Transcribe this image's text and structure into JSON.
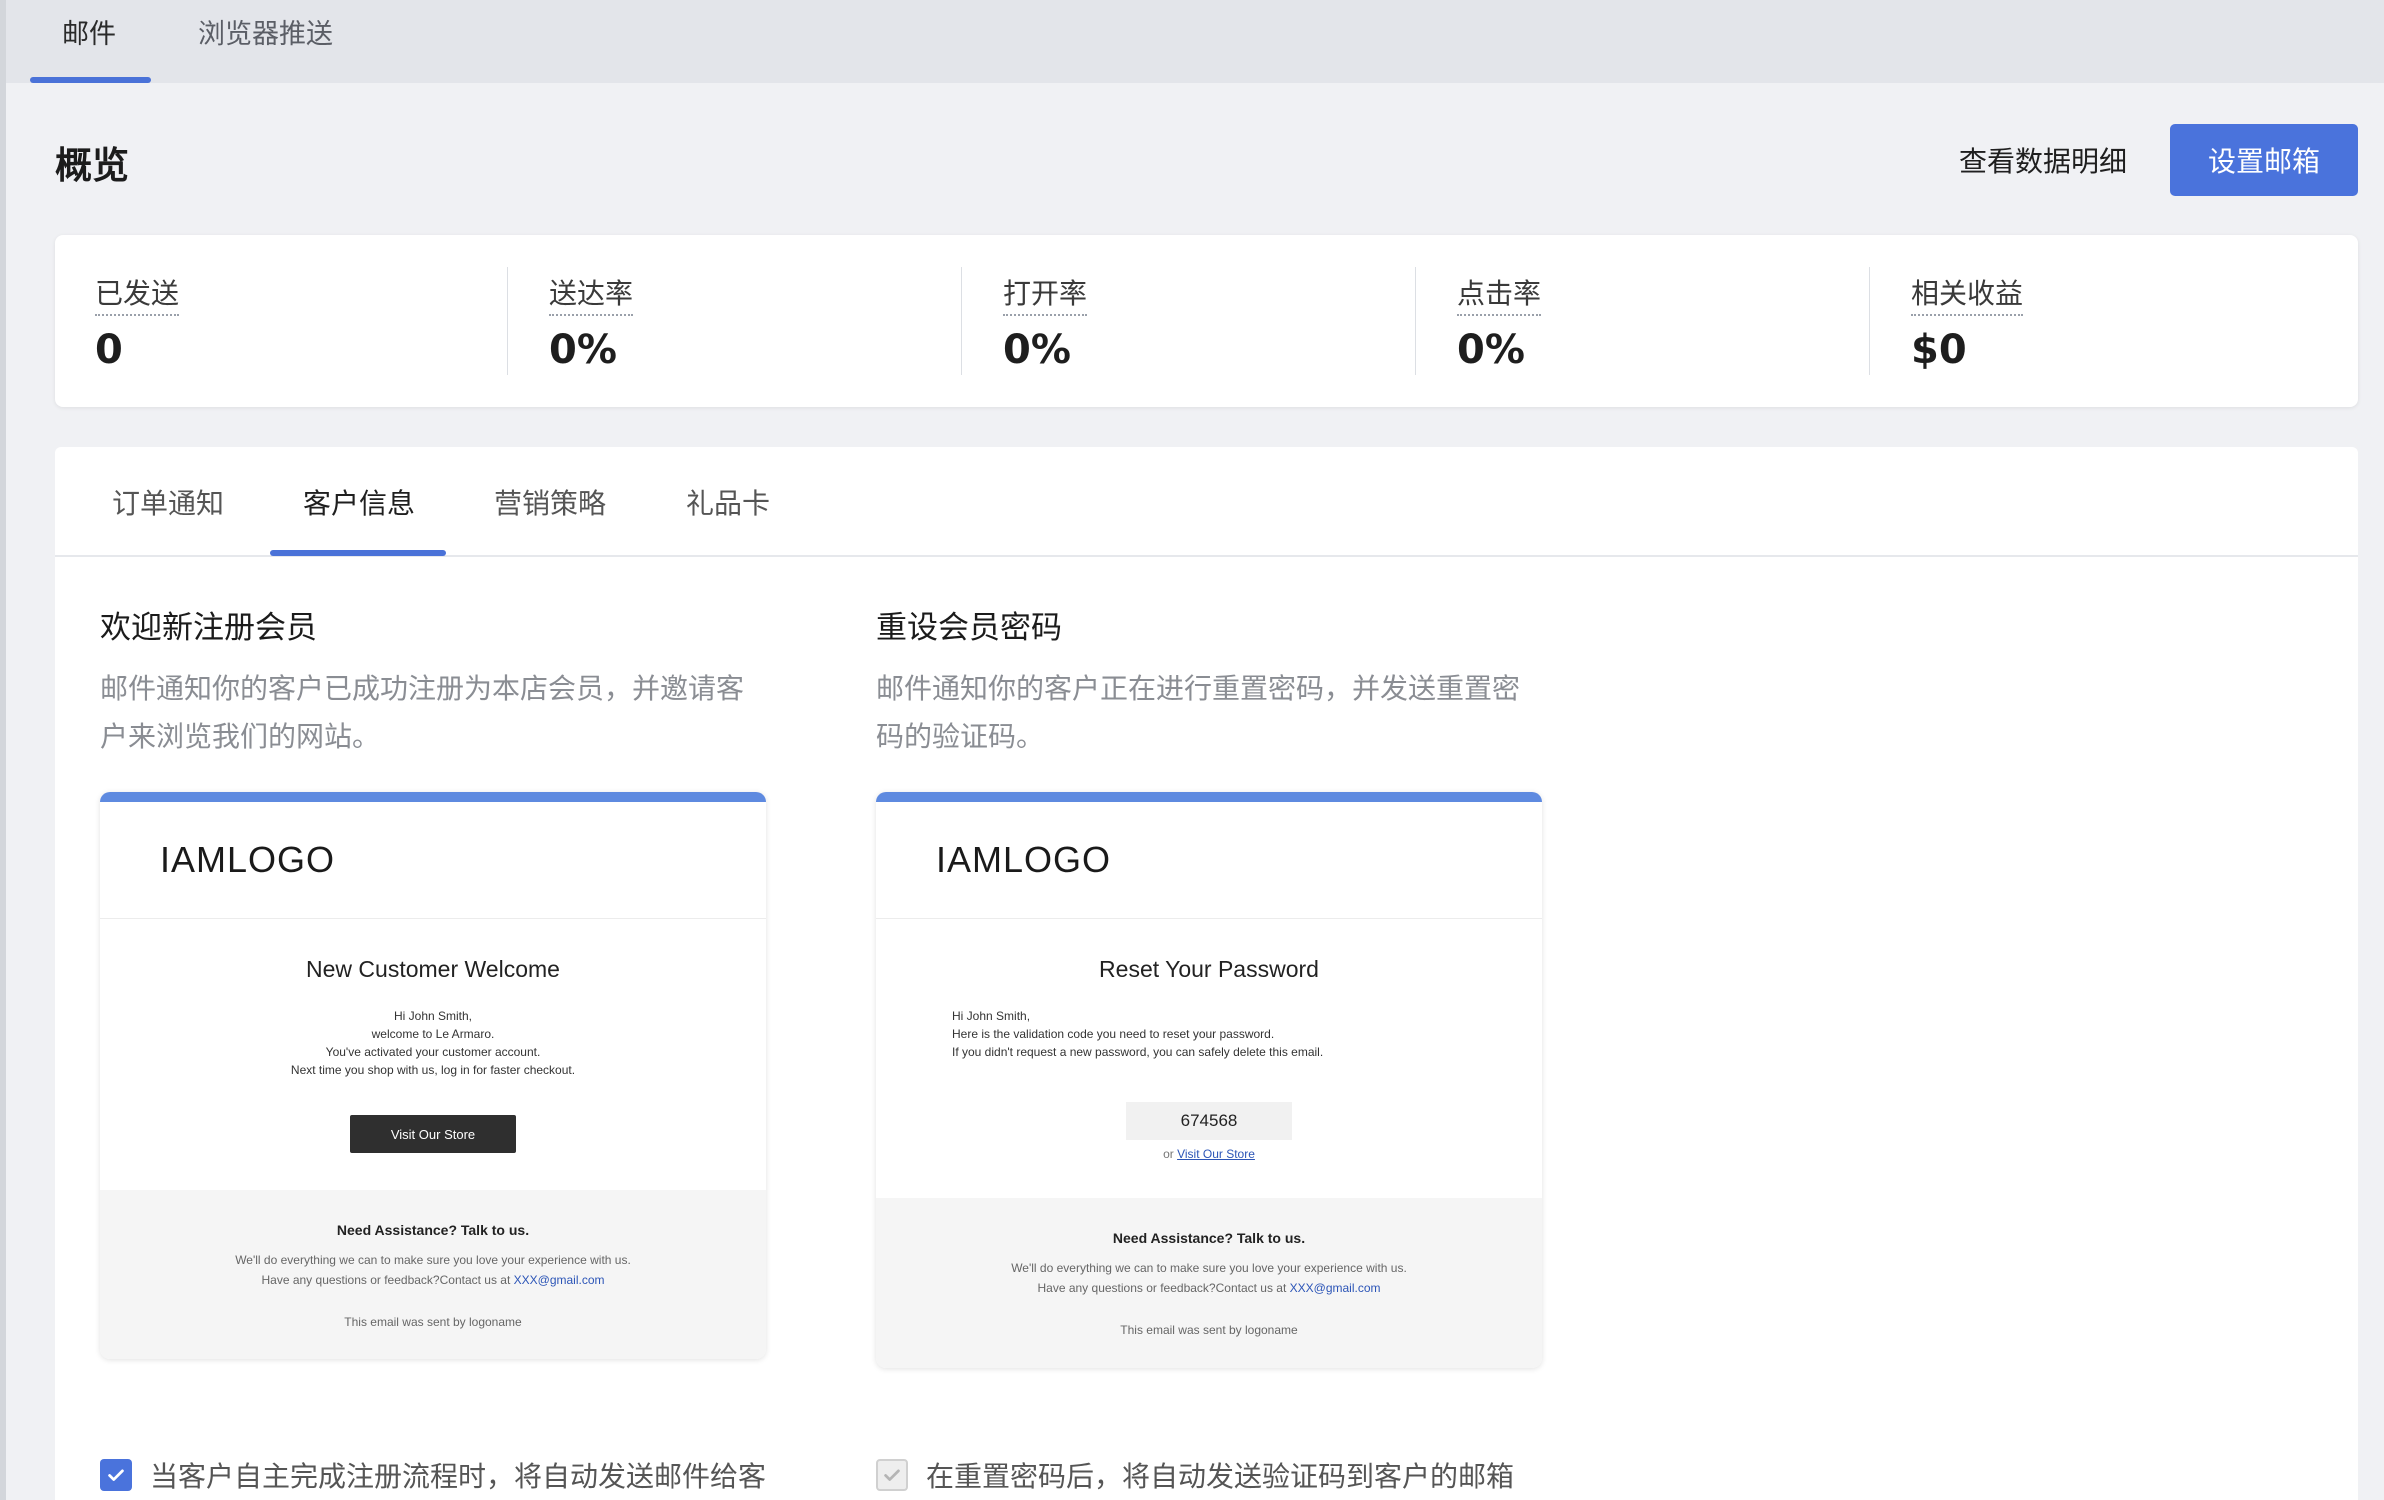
{
  "top_tabs": [
    {
      "label": "邮件",
      "active": true
    },
    {
      "label": "浏览器推送",
      "active": false
    }
  ],
  "overview": {
    "title": "概览",
    "details_link": "查看数据明细",
    "setup_button": "设置邮箱"
  },
  "stats": [
    {
      "label": "已发送",
      "value": "0"
    },
    {
      "label": "送达率",
      "value": "0%"
    },
    {
      "label": "打开率",
      "value": "0%"
    },
    {
      "label": "点击率",
      "value": "0%"
    },
    {
      "label": "相关收益",
      "value": "$0"
    }
  ],
  "sub_tabs": [
    {
      "label": "订单通知",
      "active": false
    },
    {
      "label": "客户信息",
      "active": true
    },
    {
      "label": "营销策略",
      "active": false
    },
    {
      "label": "礼品卡",
      "active": false
    }
  ],
  "cards": [
    {
      "title": "欢迎新注册会员",
      "description": "邮件通知你的客户已成功注册为本店会员，并邀请客户来浏览我们的网站。",
      "preview": {
        "logo": "IAMLOGO",
        "heading": "New Customer Welcome",
        "body": [
          "Hi  John Smith,",
          "welcome to Le Armaro.",
          "You've activated your customer account.",
          "Next time you shop with us, log in for faster checkout."
        ],
        "button": "Visit Our Store",
        "footer_title": "Need Assistance? Talk to us.",
        "footer_line1": "We'll do everything we can to make sure you love your experience with us.",
        "footer_line2_prefix": "Have any questions or feedback?Contact us at ",
        "footer_email": "XXX@gmail.com",
        "footer_sent": "This email was sent by logoname"
      },
      "checkbox_label": "当客户自主完成注册流程时，将自动发送邮件给客",
      "checked": true
    },
    {
      "title": "重设会员密码",
      "description": "邮件通知你的客户正在进行重置密码，并发送重置密码的验证码。",
      "preview": {
        "logo": "IAMLOGO",
        "heading": "Reset Your Password",
        "body": [
          "Hi  John Smith,",
          "Here is the validation code you need to reset your password.",
          "If you didn't request a new password, you can safely delete this email."
        ],
        "code": "674568",
        "or_text": "or ",
        "store_link": "Visit Our Store",
        "footer_title": "Need Assistance? Talk to us.",
        "footer_line1": "We'll do everything we can to make sure you love your experience with us.",
        "footer_line2_prefix": "Have any questions or feedback?Contact us at ",
        "footer_email": "XXX@gmail.com",
        "footer_sent": "This email was sent by logoname"
      },
      "checkbox_label": "在重置密码后，将自动发送验证码到客户的邮箱",
      "checked": true,
      "checkbox_disabled": true
    }
  ],
  "colors": {
    "accent": "#4a73dc",
    "email_topbar": "#5e8ae0",
    "page_bg": "#f0f1f4",
    "tab_bar_bg": "#e3e5ea"
  },
  "icons": [
    "check-icon"
  ]
}
